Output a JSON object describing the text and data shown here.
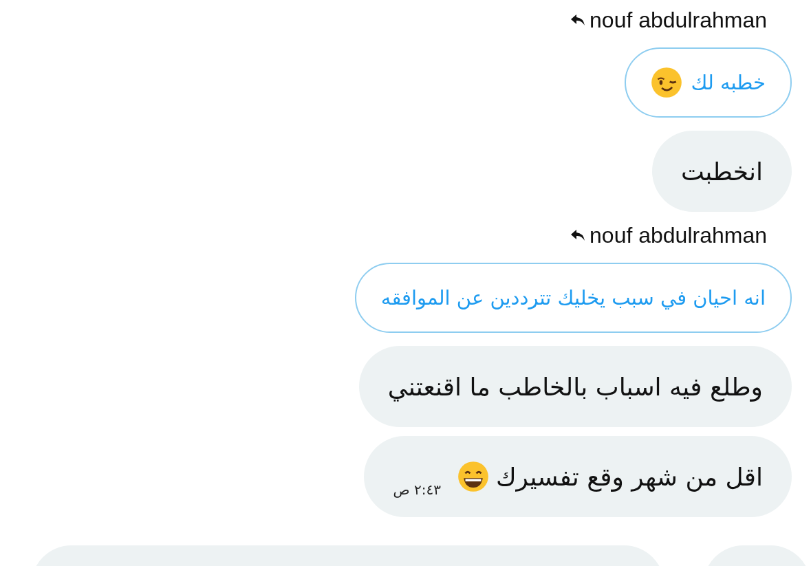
{
  "messages": [
    {
      "kind": "reply_header",
      "name": "nouf abdulrahman"
    },
    {
      "kind": "quote",
      "text": "خطبه لك",
      "emoji": {
        "kind": "wink"
      }
    },
    {
      "kind": "message",
      "text": "انخطبت"
    },
    {
      "kind": "reply_header",
      "name": "nouf abdulrahman"
    },
    {
      "kind": "quote",
      "text": "انه احيان في سبب يخليك تترددين عن الموافقه"
    },
    {
      "kind": "message",
      "text": "وطلع فيه اسباب بالخاطب ما اقنعتني"
    },
    {
      "kind": "message",
      "text": "اقل من شهر وقع تفسيرك",
      "emoji": {
        "kind": "grin"
      },
      "time": "٢:٤٣ ص"
    }
  ]
}
